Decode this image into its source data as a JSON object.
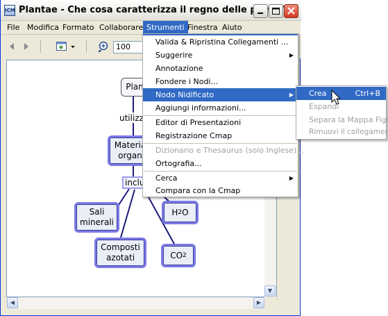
{
  "window": {
    "title": "Plantae - Che cosa caratterizza il regno delle piante?",
    "app_icon_text": "ICM"
  },
  "title_buttons": [
    "minimize",
    "maximize",
    "close"
  ],
  "menubar": [
    "File",
    "Modifica",
    "Formato",
    "Collaborare",
    "Strumenti",
    "Finestra",
    "Aiuto"
  ],
  "menubar_active": "Strumenti",
  "toolbar": {
    "zoom_value": "100"
  },
  "strumenti_menu": [
    "Valida & Ripristina Collegamenti ...",
    "Suggerire",
    "Annotazione",
    "Fondere i Nodi...",
    "Nodo Nidificato",
    "Aggiungi informazioni...",
    "Editor di Presentazioni",
    "Registrazione Cmap",
    "Dizionario e Thesaurus (solo Inglese)...",
    "Ortografia...",
    "Cerca",
    "Compara con la Cmap"
  ],
  "submenu": {
    "items": [
      "Crea",
      "Espandi",
      "Separa la Mappa Figlia",
      "Rimuovi il collegamento"
    ],
    "shortcut": "Ctrl+B"
  },
  "concept_map": {
    "nodes": {
      "root": "Plan",
      "materia": "Materia\norgan",
      "sali": "Sali\nminerali",
      "composti": "Composti\nazotati",
      "h2o_main": "H",
      "h2o_sub": "2",
      "h2o_tail": "O",
      "co2_main": "CO",
      "co2_sub": "2"
    },
    "links": {
      "utilizza": "utilizz",
      "include": "inclu"
    }
  }
}
